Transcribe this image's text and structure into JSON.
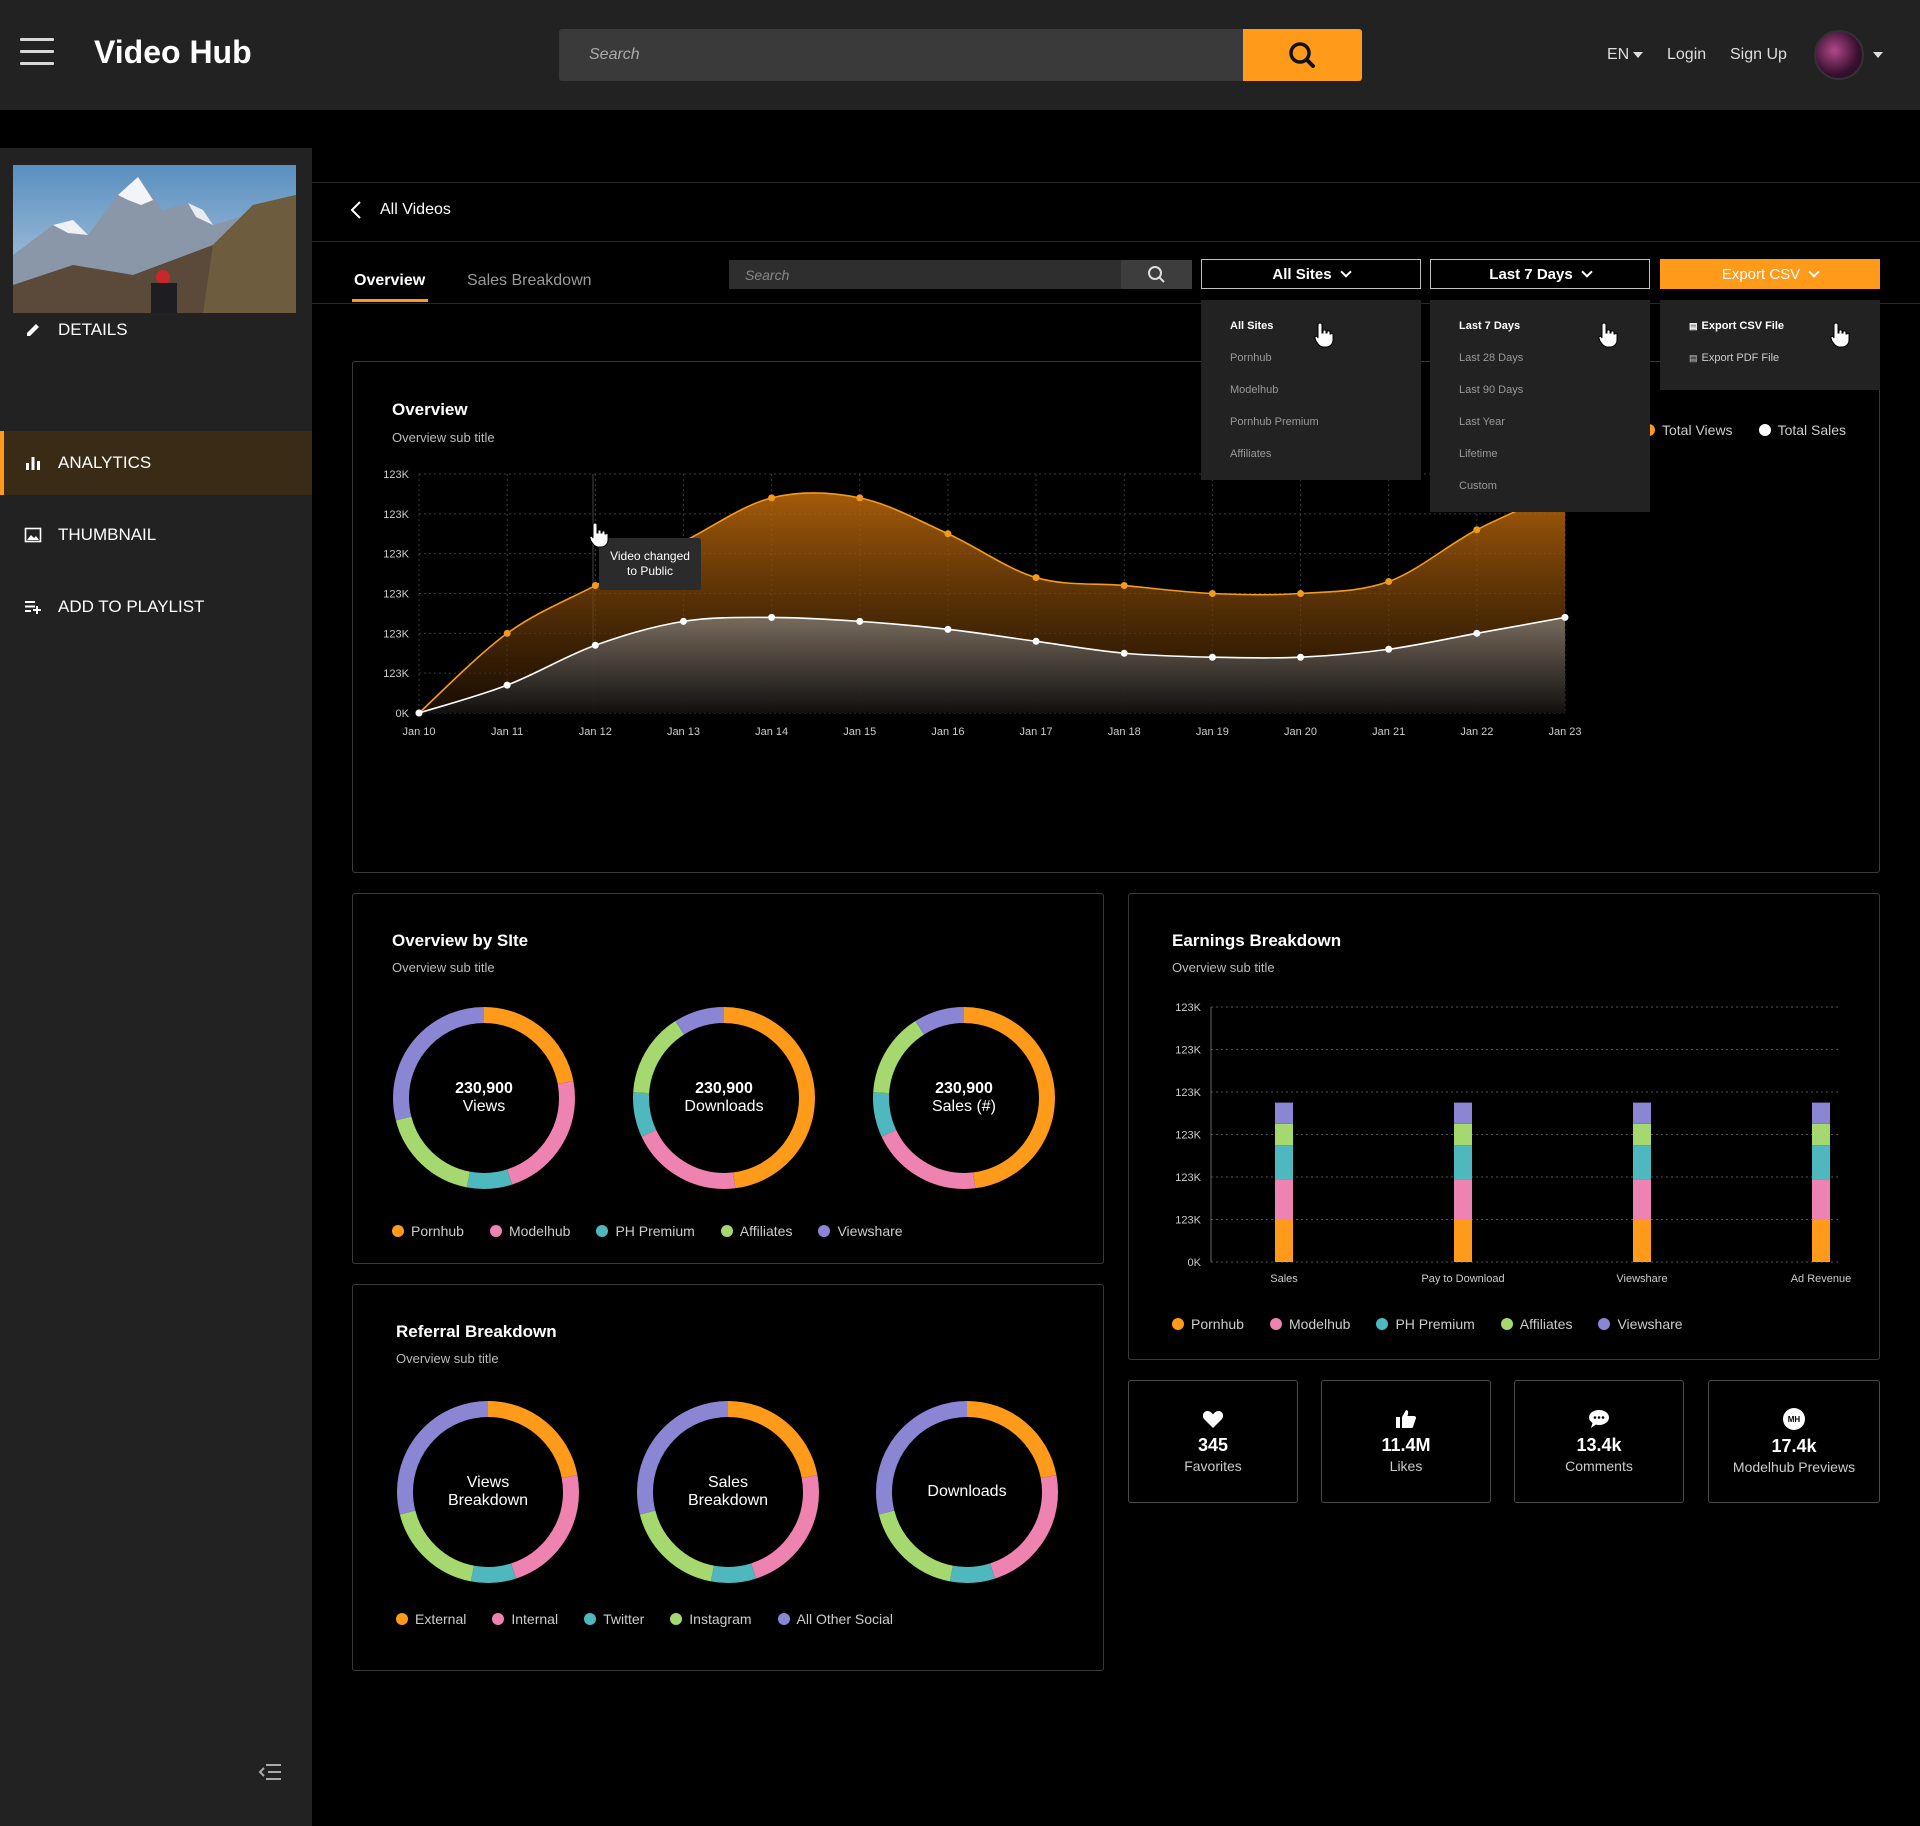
{
  "header": {
    "brand": "Video Hub",
    "search_placeholder": "Search",
    "lang": "EN",
    "login": "Login",
    "signup": "Sign Up"
  },
  "sidebar": {
    "items": [
      {
        "label": "DETAILS"
      },
      {
        "label": "ANALYTICS",
        "active": true
      },
      {
        "label": "THUMBNAIL"
      },
      {
        "label": "ADD TO PLAYLIST"
      }
    ]
  },
  "breadcrumb": {
    "back": "All Videos"
  },
  "tabs": [
    {
      "label": "Overview",
      "active": true
    },
    {
      "label": "Sales Breakdown"
    }
  ],
  "filter": {
    "search_placeholder": "Search",
    "sites_button": "All Sites",
    "range_button": "Last 7 Days",
    "export_button": "Export CSV",
    "sites_menu": [
      "All Sites",
      "Pornhub",
      "Modelhub",
      "Pornhub Premium",
      "Affiliates"
    ],
    "range_menu": [
      "Last 7 Days",
      "Last 28 Days",
      "Last 90 Days",
      "Last Year",
      "Lifetime",
      "Custom"
    ],
    "export_menu": [
      "Export CSV File",
      "Export PDF File"
    ]
  },
  "colors": {
    "accent": "#ff9a1a",
    "pornhub": "#ff9a1a",
    "modelhub": "#ee82b0",
    "ph_premium": "#4fb8bf",
    "affiliates": "#a5d96f",
    "viewshare": "#8a86d4",
    "views": "#f39a1d",
    "sales": "#ffffff"
  },
  "overview_chart": {
    "title": "Overview",
    "subtitle": "Overview sub title",
    "legend": [
      "Total Views",
      "Total Sales"
    ],
    "tooltip": "Video changed to Public",
    "chart_data": {
      "type": "area",
      "categories": [
        "Jan 10",
        "Jan 11",
        "Jan 12",
        "Jan 13",
        "Jan 14",
        "Jan 15",
        "Jan 16",
        "Jan 17",
        "Jan 18",
        "Jan 19",
        "Jan 20",
        "Jan 21",
        "Jan 22",
        "Jan 23"
      ],
      "y_tick_labels": [
        "0K",
        "123K",
        "123K",
        "123K",
        "123K",
        "123K",
        "123K"
      ],
      "ylim": [
        0,
        6
      ],
      "grid": true,
      "legend_position": "top-right",
      "series": [
        {
          "name": "Total Views",
          "values": [
            0,
            2.0,
            3.2,
            4.3,
            5.4,
            5.4,
            4.5,
            3.4,
            3.2,
            3.0,
            3.0,
            3.3,
            4.6,
            5.6
          ]
        },
        {
          "name": "Total Sales",
          "values": [
            0,
            0.7,
            1.7,
            2.3,
            2.4,
            2.3,
            2.1,
            1.8,
            1.5,
            1.4,
            1.4,
            1.6,
            2.0,
            2.4
          ]
        }
      ]
    }
  },
  "overview_by_site": {
    "title": "Overview by SIte",
    "subtitle": "Overview sub title",
    "donuts": [
      {
        "value": "230,900",
        "label": "Views",
        "segments": [
          0.22,
          0.23,
          0.08,
          0.18,
          0.29
        ]
      },
      {
        "value": "230,900",
        "label": "Downloads",
        "segments": [
          0.48,
          0.2,
          0.08,
          0.15,
          0.09
        ]
      },
      {
        "value": "230,900",
        "label": "Sales (#)",
        "segments": [
          0.48,
          0.2,
          0.08,
          0.15,
          0.09
        ]
      }
    ],
    "legend": [
      "Pornhub",
      "Modelhub",
      "PH Premium",
      "Affiliates",
      "Viewshare"
    ]
  },
  "referral": {
    "title": "Referral Breakdown",
    "subtitle": "Overview sub title",
    "donuts": [
      {
        "label1": "Views",
        "label2": "Breakdown",
        "segments": [
          0.22,
          0.23,
          0.08,
          0.18,
          0.29
        ]
      },
      {
        "label1": "Sales",
        "label2": "Breakdown",
        "segments": [
          0.22,
          0.23,
          0.08,
          0.18,
          0.29
        ]
      },
      {
        "label1": "Downloads",
        "label2": "",
        "segments": [
          0.22,
          0.23,
          0.08,
          0.18,
          0.29
        ]
      }
    ],
    "legend": [
      "External",
      "Internal",
      "Twitter",
      "Instagram",
      "All Other Social"
    ]
  },
  "earnings": {
    "title": "Earnings Breakdown",
    "subtitle": "Overview sub title",
    "legend": [
      "Pornhub",
      "Modelhub",
      "PH Premium",
      "Affiliates",
      "Viewshare"
    ],
    "chart_data": {
      "type": "bar",
      "stacked": true,
      "categories": [
        "Sales",
        "Pay to Download",
        "Viewshare",
        "Ad Revenue"
      ],
      "y_tick_labels": [
        "0K",
        "123K",
        "123K",
        "123K",
        "123K",
        "123K",
        "123K"
      ],
      "ylim": [
        0,
        6
      ],
      "series": [
        {
          "name": "Pornhub",
          "values": [
            1.0,
            1.0,
            1.0,
            1.0
          ]
        },
        {
          "name": "Modelhub",
          "values": [
            0.95,
            0.95,
            0.95,
            0.95
          ]
        },
        {
          "name": "PH Premium",
          "values": [
            0.8,
            0.8,
            0.8,
            0.8
          ]
        },
        {
          "name": "Affiliates",
          "values": [
            0.5,
            0.5,
            0.5,
            0.5
          ]
        },
        {
          "name": "Viewshare",
          "values": [
            0.5,
            0.5,
            0.5,
            0.5
          ]
        }
      ]
    }
  },
  "stats": [
    {
      "icon": "heart-icon",
      "value": "345",
      "label": "Favorites"
    },
    {
      "icon": "thumbs-up-icon",
      "value": "11.4M",
      "label": "Likes"
    },
    {
      "icon": "comment-icon",
      "value": "13.4k",
      "label": "Comments"
    },
    {
      "icon": "modelhub-icon",
      "value": "17.4k",
      "label": "Modelhub Previews",
      "badge": "MH"
    }
  ]
}
